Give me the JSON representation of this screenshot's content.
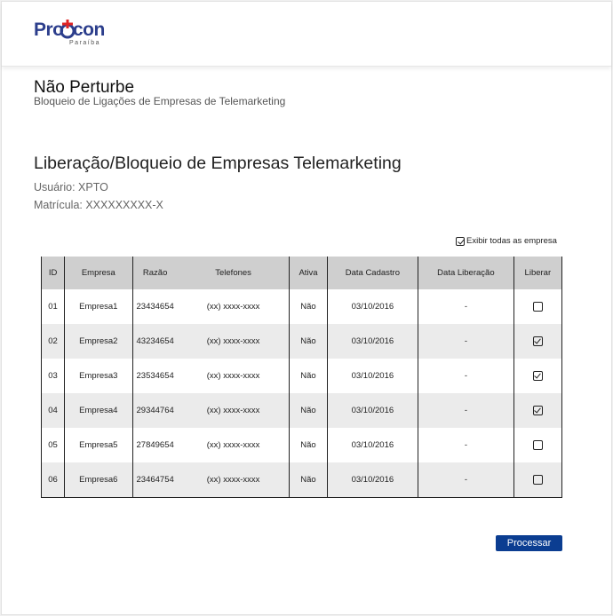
{
  "logo": {
    "brand_left": "Pro",
    "brand_right": "con",
    "subtitle": "Paraíba"
  },
  "app": {
    "title": "Não Perturbe",
    "subtitle": "Bloqueio de Ligações de Empresas de Telemarketing"
  },
  "page": {
    "title": "Liberação/Bloqueio de Empresas Telemarketing",
    "user": "Usuário: XPTO",
    "registration": "Matrícula: XXXXXXXXX-X"
  },
  "filter": {
    "show_all_label": "Exibir todas as empresa",
    "show_all_checked": true
  },
  "table": {
    "headers": [
      "ID",
      "Empresa",
      "Razão",
      "Telefones",
      "Ativa",
      "Data Cadastro",
      "Data Liberação",
      "Liberar"
    ],
    "rows": [
      {
        "id": "01",
        "empresa": "Empresa1",
        "razao": "23434654",
        "telefones": "(xx) xxxx-xxxx",
        "ativa": "Não",
        "data_cadastro": "03/10/2016",
        "data_liberacao": "-",
        "liberar": false
      },
      {
        "id": "02",
        "empresa": "Empresa2",
        "razao": "43234654",
        "telefones": "(xx) xxxx-xxxx",
        "ativa": "Não",
        "data_cadastro": "03/10/2016",
        "data_liberacao": "-",
        "liberar": true
      },
      {
        "id": "03",
        "empresa": "Empresa3",
        "razao": "23534654",
        "telefones": "(xx) xxxx-xxxx",
        "ativa": "Não",
        "data_cadastro": "03/10/2016",
        "data_liberacao": "-",
        "liberar": true
      },
      {
        "id": "04",
        "empresa": "Empresa4",
        "razao": "29344764",
        "telefones": "(xx) xxxx-xxxx",
        "ativa": "Não",
        "data_cadastro": "03/10/2016",
        "data_liberacao": "-",
        "liberar": true
      },
      {
        "id": "05",
        "empresa": "Empresa5",
        "razao": "27849654",
        "telefones": "(xx) xxxx-xxxx",
        "ativa": "Não",
        "data_cadastro": "03/10/2016",
        "data_liberacao": "-",
        "liberar": false
      },
      {
        "id": "06",
        "empresa": "Empresa6",
        "razao": "23464754",
        "telefones": "(xx) xxxx-xxxx",
        "ativa": "Não",
        "data_cadastro": "03/10/2016",
        "data_liberacao": "-",
        "liberar": false
      }
    ]
  },
  "actions": {
    "process_label": "Processar"
  },
  "colors": {
    "brand_blue": "#2c3e8c",
    "brand_red": "#e02424",
    "button_blue": "#0b3d91",
    "header_gray": "#cfcfcf",
    "row_alt": "#ebebeb"
  }
}
